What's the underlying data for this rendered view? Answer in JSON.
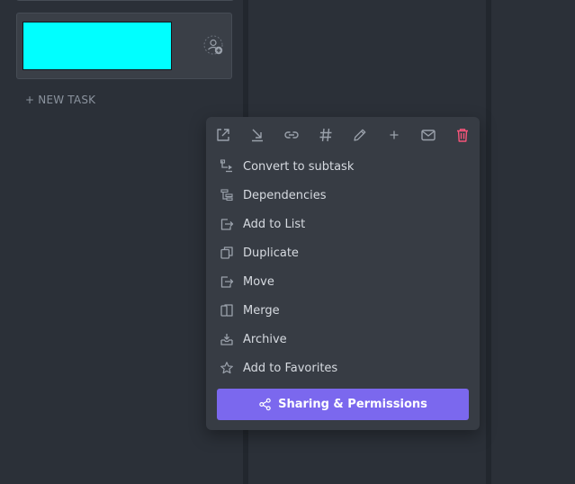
{
  "board": {
    "new_task_label": "+ NEW TASK",
    "task_name_value": ""
  },
  "menu": {
    "toolbar_icons": [
      "new-tab-icon",
      "download-icon",
      "link-icon",
      "hash-icon",
      "pencil-icon",
      "plus-icon",
      "mail-icon",
      "trash-icon"
    ],
    "items": [
      {
        "label": "Convert to subtask",
        "icon": "subtask-icon"
      },
      {
        "label": "Dependencies",
        "icon": "dependencies-icon"
      },
      {
        "label": "Add to List",
        "icon": "add-to-list-icon"
      },
      {
        "label": "Duplicate",
        "icon": "duplicate-icon"
      },
      {
        "label": "Move",
        "icon": "move-icon"
      },
      {
        "label": "Merge",
        "icon": "merge-icon"
      },
      {
        "label": "Archive",
        "icon": "archive-icon"
      },
      {
        "label": "Add to Favorites",
        "icon": "star-icon"
      }
    ],
    "share_button_label": "Sharing & Permissions"
  },
  "colors": {
    "background": "#2b3038",
    "menu_background": "#373c44",
    "accent": "#7b68ee",
    "danger": "#f7557a",
    "task_highlight": "#00ffff"
  }
}
